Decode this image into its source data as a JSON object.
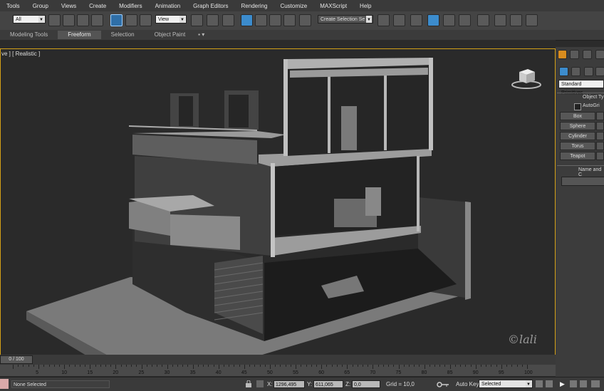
{
  "menu": [
    "Tools",
    "Group",
    "Views",
    "Create",
    "Modifiers",
    "Animation",
    "Graph Editors",
    "Rendering",
    "Customize",
    "MAXScript",
    "Help"
  ],
  "toolbar": {
    "selection_filter": "All",
    "reference_coord": "View",
    "selection_set": "Create Selection Se"
  },
  "ribbon": {
    "tabs": [
      "Modeling Tools",
      "Freeform",
      "Selection",
      "Object Paint"
    ],
    "active": "Freeform"
  },
  "viewport": {
    "label": "ve ] [ Realistic ]",
    "watermark": "©lali"
  },
  "command_panel": {
    "category": "Standard Primitives",
    "rollout_object_type": "Object Ty",
    "autogrid": "AutoGri",
    "buttons": [
      "Box",
      "Sphere",
      "Cylinder",
      "Torus",
      "Teapot"
    ],
    "rollout_name_color": "Name and C"
  },
  "timeline": {
    "frame": "0 / 100",
    "ticks": [
      "5",
      "10",
      "15",
      "20",
      "25",
      "30",
      "35",
      "40",
      "45",
      "50",
      "55",
      "60",
      "65",
      "70",
      "75",
      "80",
      "85",
      "90",
      "95",
      "100"
    ]
  },
  "status": {
    "selection": "None Selected",
    "x_label": "X:",
    "x_value": "1296,495",
    "y_label": "Y:",
    "y_value": "611,065",
    "z_label": "Z:",
    "z_value": "0,0",
    "grid": "Grid = 10,0",
    "auto_key": "Auto Key",
    "key_mode": "Selected"
  },
  "colors": {
    "viewport_border": "#d4a017",
    "active_tool": "#3c8ccd"
  }
}
